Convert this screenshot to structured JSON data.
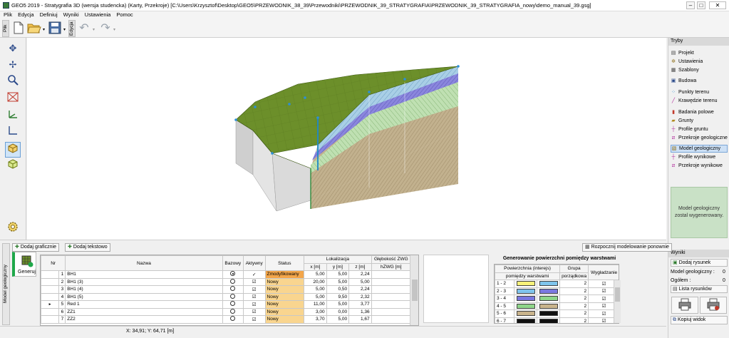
{
  "window": {
    "title": "GEO5 2019 - Stratygrafia 3D (wersja studencka) (Karty, Przekroje) [C:\\Users\\Krzysztof\\Desktop\\GEO5\\PRZEWODNIK_38_39\\Przewodniki\\PRZEWODNIK_39_STRATYGRAFIA\\PRZEWODNIK_39_STRATYGRAFIA_nowy\\demo_manual_39.gsg]",
    "minimize": "–",
    "maximize": "□",
    "close": "✕"
  },
  "menu": [
    "Plik",
    "Edycja",
    "Definiuj",
    "Wyniki",
    "Ustawienia",
    "Pomoc"
  ],
  "toolbar": {
    "tab_file": "Plik",
    "tab_edit": "Edycja"
  },
  "right_panel": {
    "modes_header": "Tryby",
    "items": [
      {
        "label": "Projekt",
        "icon": "list-icon"
      },
      {
        "label": "Ustawienia",
        "icon": "gear-icon"
      },
      {
        "label": "Szablony",
        "icon": "template-icon"
      },
      {
        "label": "Budowa",
        "icon": "building-icon"
      },
      {
        "label": "Punkty terenu",
        "icon": "points-icon"
      },
      {
        "label": "Krawędzie terenu",
        "icon": "edge-icon"
      },
      {
        "label": "Badania polowe",
        "icon": "borehole-icon"
      },
      {
        "label": "Grunty",
        "icon": "soil-icon"
      },
      {
        "label": "Profile gruntu",
        "icon": "profile-icon"
      },
      {
        "label": "Przekroje geologiczne",
        "icon": "section-icon"
      },
      {
        "label": "Model geologiczny",
        "icon": "model-icon"
      },
      {
        "label": "Profile wynikowe",
        "icon": "result-profile-icon"
      },
      {
        "label": "Przekroje wynikowe",
        "icon": "result-section-icon"
      }
    ],
    "message": "Model geologiczny zostal wygenerowany.",
    "results_header": "Wyniki",
    "add_drawing": "Dodaj rysunek",
    "model_count_label": "Model geologiczny :",
    "model_count": "0",
    "total_label": "Ogółem :",
    "total": "0",
    "drawings_list": "Lista rysunków",
    "copy_view": "Kopiuj widok"
  },
  "bottom_panel": {
    "side_tab": "Model geologiczny",
    "generate": "Generuj",
    "add_graphic": "Dodaj graficznie",
    "add_text": "Dodaj tekstowo",
    "start_modeling": "Rozpocznij modelowanie ponownie",
    "table": {
      "headers": {
        "nr": "Nr",
        "name": "Nazwa",
        "base": "Bazowy",
        "active": "Aktywny",
        "status": "Status",
        "location": "Lokalizacja",
        "x": "x [m]",
        "y": "y [m]",
        "z": "z [m]",
        "depth": "Głębokość ZWG",
        "depth_unit": "hZWG [m]"
      },
      "rows": [
        {
          "nr": "1",
          "name": "BH1",
          "base": "radio-on",
          "active": "✓",
          "status": "Zmodyfikowany",
          "x": "5,00",
          "y": "5,00",
          "z": "2,24",
          "depth": ""
        },
        {
          "nr": "2",
          "name": "BH1 (3)",
          "base": "radio",
          "active": "☑",
          "status": "Nowy",
          "x": "20,00",
          "y": "5,00",
          "z": "5,00",
          "depth": ""
        },
        {
          "nr": "3",
          "name": "BH1 (4)",
          "base": "radio",
          "active": "☑",
          "status": "Nowy",
          "x": "5,00",
          "y": "0,50",
          "z": "2,24",
          "depth": ""
        },
        {
          "nr": "4",
          "name": "BH1 (5)",
          "base": "radio",
          "active": "☑",
          "status": "Nowy",
          "x": "5,00",
          "y": "9,50",
          "z": "2,32",
          "depth": ""
        },
        {
          "nr": "5",
          "name": "Red 1",
          "base": "radio",
          "active": "☑",
          "status": "Nowy",
          "x": "11,00",
          "y": "5,00",
          "z": "3,77",
          "depth": ""
        },
        {
          "nr": "6",
          "name": "ZZ1",
          "base": "radio",
          "active": "☑",
          "status": "Nowy",
          "x": "3,00",
          "y": "0,00",
          "z": "1,36",
          "depth": ""
        },
        {
          "nr": "7",
          "name": "ZZ2",
          "base": "radio",
          "active": "☑",
          "status": "Nowy",
          "x": "3,70",
          "y": "5,00",
          "z": "1,67",
          "depth": ""
        }
      ],
      "current_row_marker": "►"
    },
    "surfaces": {
      "title": "Generowanie powierzchni pomiędzy warstwami",
      "headers": {
        "surface": "Powierzchnia (interejs)",
        "surface2": "pomiędzy warstwami",
        "group": "Grupa",
        "group2": "porządkowa",
        "smoothing": "Wygładzanie"
      },
      "rows": [
        {
          "pair": "1 - 2",
          "c1": "#f7f27a",
          "c2": "#7fc4ec",
          "group": "2",
          "smooth": "☑"
        },
        {
          "pair": "2 - 3",
          "c1": "#7fc4ec",
          "c2": "#7a78e0",
          "group": "2",
          "smooth": "☑"
        },
        {
          "pair": "3 - 4",
          "c1": "#7a78e0",
          "c2": "#8fd68a",
          "group": "2",
          "smooth": "☑"
        },
        {
          "pair": "4 - 5",
          "c1": "#8fd68a",
          "c2": "#c9b48c",
          "group": "2",
          "smooth": "☑"
        },
        {
          "pair": "5 - 6",
          "c1": "#c9b48c",
          "c2": "#111111",
          "group": "2",
          "smooth": "☑"
        },
        {
          "pair": "6 - 7",
          "c1": "#111111",
          "c2": "#111111",
          "group": "2",
          "smooth": "☑"
        }
      ]
    }
  },
  "status": {
    "coords": "X: 34,91; Y: 64,71 [m]"
  }
}
